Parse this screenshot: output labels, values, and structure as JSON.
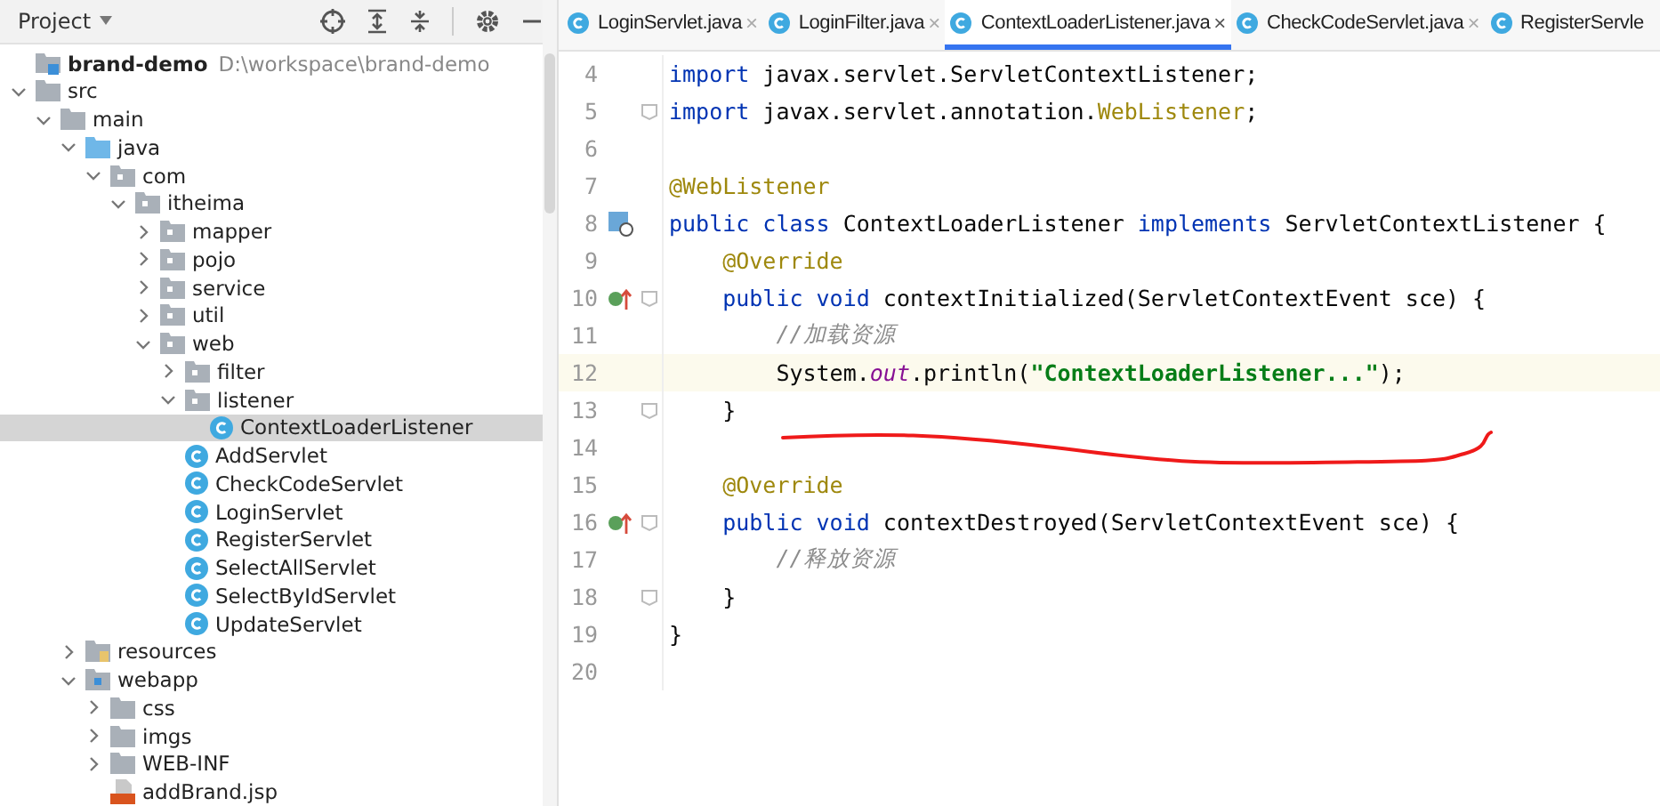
{
  "project_panel": {
    "title": "Project",
    "root": {
      "name": "brand-demo",
      "path": "D:\\workspace\\brand-demo",
      "children": [
        {
          "name": "src",
          "kind": "folder",
          "expanded": true,
          "children": [
            {
              "name": "main",
              "kind": "folder",
              "expanded": true,
              "children": [
                {
                  "name": "java",
                  "kind": "source-folder",
                  "expanded": true,
                  "children": [
                    {
                      "name": "com",
                      "kind": "package",
                      "expanded": true,
                      "children": [
                        {
                          "name": "itheima",
                          "kind": "package",
                          "expanded": true,
                          "children": [
                            {
                              "name": "mapper",
                              "kind": "package",
                              "expanded": false
                            },
                            {
                              "name": "pojo",
                              "kind": "package",
                              "expanded": false
                            },
                            {
                              "name": "service",
                              "kind": "package",
                              "expanded": false
                            },
                            {
                              "name": "util",
                              "kind": "package",
                              "expanded": false
                            },
                            {
                              "name": "web",
                              "kind": "package",
                              "expanded": true,
                              "children": [
                                {
                                  "name": "filter",
                                  "kind": "package",
                                  "expanded": false
                                },
                                {
                                  "name": "listener",
                                  "kind": "package",
                                  "expanded": true,
                                  "children": [
                                    {
                                      "name": "ContextLoaderListener",
                                      "kind": "class",
                                      "selected": true
                                    }
                                  ]
                                },
                                {
                                  "name": "AddServlet",
                                  "kind": "class",
                                  "selected": false
                                },
                                {
                                  "name": "CheckCodeServlet",
                                  "kind": "class",
                                  "selected": false
                                },
                                {
                                  "name": "LoginServlet",
                                  "kind": "class",
                                  "selected": false
                                },
                                {
                                  "name": "RegisterServlet",
                                  "kind": "class",
                                  "selected": false
                                },
                                {
                                  "name": "SelectAllServlet",
                                  "kind": "class",
                                  "selected": false
                                },
                                {
                                  "name": "SelectByIdServlet",
                                  "kind": "class",
                                  "selected": false
                                },
                                {
                                  "name": "UpdateServlet",
                                  "kind": "class",
                                  "selected": false
                                }
                              ]
                            }
                          ]
                        }
                      ]
                    }
                  ]
                },
                {
                  "name": "resources",
                  "kind": "resources-folder",
                  "expanded": false
                },
                {
                  "name": "webapp",
                  "kind": "web-folder",
                  "expanded": true,
                  "children": [
                    {
                      "name": "css",
                      "kind": "folder",
                      "expanded": false
                    },
                    {
                      "name": "imgs",
                      "kind": "folder",
                      "expanded": false
                    },
                    {
                      "name": "WEB-INF",
                      "kind": "folder",
                      "expanded": false
                    },
                    {
                      "name": "addBrand.jsp",
                      "kind": "jsp"
                    }
                  ]
                }
              ]
            }
          ]
        }
      ]
    }
  },
  "tabs": [
    {
      "label": "LoginServlet.java",
      "close": "×",
      "selected": false
    },
    {
      "label": "LoginFilter.java",
      "close": "×",
      "selected": false
    },
    {
      "label": "ContextLoaderListener.java",
      "close": "×",
      "selected": true
    },
    {
      "label": "CheckCodeServlet.java",
      "close": "×",
      "selected": false
    },
    {
      "label": "RegisterServle",
      "selected": false
    }
  ],
  "editor": {
    "lines": [
      {
        "number": "4",
        "tokens": [
          {
            "kind": "keyword",
            "text": "import"
          },
          {
            "kind": "plain",
            "text": " javax.servlet.ServletContextListener;"
          }
        ]
      },
      {
        "number": "5",
        "fold": true,
        "tokens": [
          {
            "kind": "keyword",
            "text": "import"
          },
          {
            "kind": "plain",
            "text": " javax.servlet.annotation."
          },
          {
            "kind": "annotation",
            "text": "WebListener"
          },
          {
            "kind": "plain",
            "text": ";"
          }
        ]
      },
      {
        "number": "6"
      },
      {
        "number": "7",
        "tokens": [
          {
            "kind": "annotation",
            "text": "@WebListener"
          }
        ]
      },
      {
        "number": "8",
        "implemented_marker": true,
        "tokens": [
          {
            "kind": "keyword",
            "text": "public class"
          },
          {
            "kind": "plain",
            "text": " ContextLoaderListener "
          },
          {
            "kind": "keyword",
            "text": "implements"
          },
          {
            "kind": "plain",
            "text": " ServletContextListener {"
          }
        ]
      },
      {
        "number": "9",
        "tokens": [
          {
            "kind": "annotation",
            "text": "    @Override"
          }
        ]
      },
      {
        "number": "10",
        "override_marker": true,
        "fold": true,
        "tokens": [
          {
            "kind": "keyword",
            "text": "    public void"
          },
          {
            "kind": "plain",
            "text": " contextInitialized(ServletContextEvent sce) {"
          }
        ]
      },
      {
        "number": "11",
        "tokens": [
          {
            "kind": "comment",
            "text": "        //加载资源"
          }
        ]
      },
      {
        "number": "12",
        "current": true,
        "tokens": [
          {
            "kind": "plain",
            "text": "        System."
          },
          {
            "kind": "static",
            "text": "out"
          },
          {
            "kind": "plain",
            "text": ".println("
          },
          {
            "kind": "string",
            "text": "\"ContextLoaderListener...\""
          },
          {
            "kind": "plain",
            "text": ");"
          }
        ]
      },
      {
        "number": "13",
        "fold": true,
        "tokens": [
          {
            "kind": "plain",
            "text": "    }"
          }
        ]
      },
      {
        "number": "14"
      },
      {
        "number": "15",
        "tokens": [
          {
            "kind": "annotation",
            "text": "    @Override"
          }
        ]
      },
      {
        "number": "16",
        "override_marker": true,
        "fold": true,
        "tokens": [
          {
            "kind": "keyword",
            "text": "    public void"
          },
          {
            "kind": "plain",
            "text": " contextDestroyed(ServletContextEvent sce) {"
          }
        ]
      },
      {
        "number": "17",
        "tokens": [
          {
            "kind": "comment",
            "text": "        //释放资源"
          }
        ]
      },
      {
        "number": "18",
        "fold": true,
        "tokens": [
          {
            "kind": "plain",
            "text": "    }"
          }
        ]
      },
      {
        "number": "19",
        "tokens": [
          {
            "kind": "plain",
            "text": "}"
          }
        ]
      },
      {
        "number": "20"
      }
    ]
  }
}
